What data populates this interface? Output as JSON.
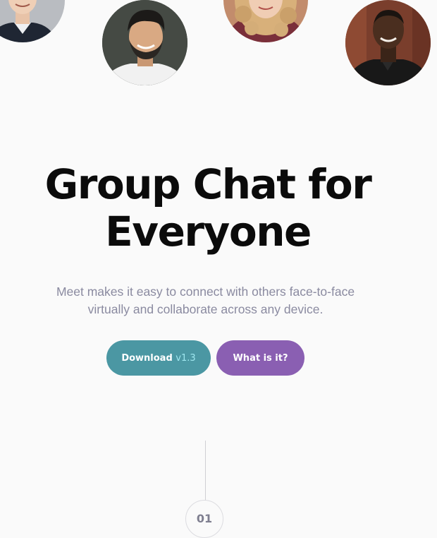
{
  "hero": {
    "title_line1": "Group Chat for",
    "title_line2": "Everyone",
    "subtitle_line1": "Meet makes it easy to connect with others face-to-face",
    "subtitle_line2": "virtually and collaborate across any device."
  },
  "buttons": {
    "download_label": "Download",
    "download_version": "v1.3",
    "what_label": "What is it?"
  },
  "step": {
    "number": "01"
  },
  "colors": {
    "background": "#fafafa",
    "title": "#0b0b0b",
    "subtitle": "#8a8aa0",
    "download_button": "#4b97a3",
    "version_text": "#9fe7ef",
    "what_button": "#8a5fb2",
    "divider": "#cfcfd4"
  }
}
